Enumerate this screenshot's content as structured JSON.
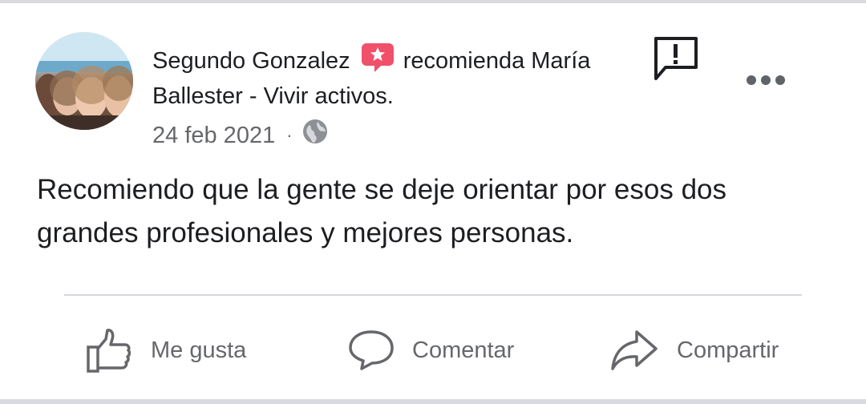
{
  "post": {
    "author": "Segundo Gonzalez",
    "action_text": "recomienda María",
    "page_name": "Ballester - Vivir activos.",
    "date": "24 feb 2021",
    "separator": "·",
    "privacy_icon": "globe-icon",
    "badge_icon": "recommendation-star-icon",
    "body": "Recomiendo que la gente se deje orientar por esos dos grandes profesionales y mejores personas."
  },
  "header_actions": {
    "report_icon": "report-icon",
    "more_icon": "more-options-icon"
  },
  "actions": {
    "like_label": "Me gusta",
    "comment_label": "Comentar",
    "share_label": "Compartir"
  },
  "colors": {
    "badge": "#f0506a",
    "text": "#1c1e21",
    "secondary_text": "#65676b",
    "divider": "#d4d6da"
  }
}
